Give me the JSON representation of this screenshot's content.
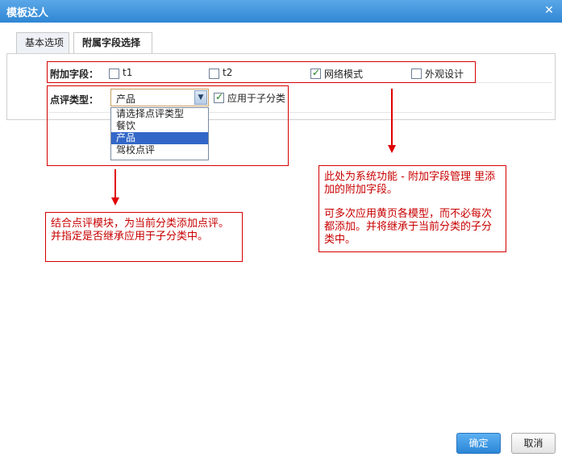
{
  "window": {
    "title": "模板达人",
    "close_glyph": "✕"
  },
  "tabs": [
    {
      "label": "基本选项"
    },
    {
      "label": "附属字段选择"
    }
  ],
  "extra_fields": {
    "label": "附加字段：",
    "options": [
      {
        "label": "t1",
        "checked": false
      },
      {
        "label": "t2",
        "checked": false
      },
      {
        "label": "网络模式",
        "checked": true
      },
      {
        "label": "外观设计",
        "checked": false
      }
    ]
  },
  "review_type": {
    "label": "点评类型：",
    "selected": "产品",
    "dropdown_glyph": "▼",
    "options": [
      "请选择点评类型",
      "餐饮",
      "产品",
      "驾校点评"
    ],
    "apply_sub": {
      "label": "应用于子分类",
      "checked": true
    }
  },
  "notes": {
    "left": "结合点评模块，为当前分类添加点评。并指定是否继承应用于子分类中。",
    "right_p1": "此处为系统功能 - 附加字段管理 里添加的附加字段。",
    "right_p2": "可多次应用黄页各模型，而不必每次都添加。并将继承于当前分类的子分类中。"
  },
  "buttons": {
    "ok": "确定",
    "cancel": "取消"
  },
  "colors": {
    "accent": "#2f86d4",
    "annotation": "#d40000"
  }
}
